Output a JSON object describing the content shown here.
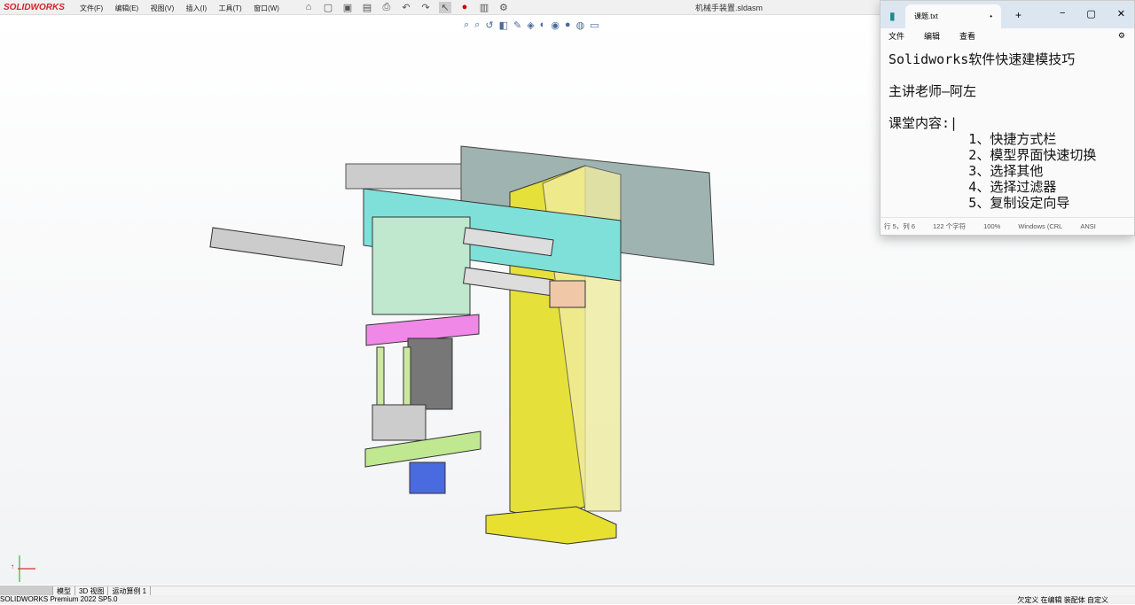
{
  "app": {
    "brand": "SOLIDWORKS",
    "menu": [
      "文件(F)",
      "编辑(E)",
      "视图(V)",
      "插入(I)",
      "工具(T)",
      "窗口(W)"
    ],
    "doc_title": "机械手装置.sldasm"
  },
  "tabs": [
    "模型",
    "3D 视图",
    "运动算例 1"
  ],
  "status": {
    "version": "SOLIDWORKS Premium 2022 SP5.0",
    "right": "欠定义   在编辑 装配体        自定义"
  },
  "notepad": {
    "tab": "课题.txt",
    "menu": [
      "文件",
      "编辑",
      "查看"
    ],
    "lines": [
      "Solidworks软件快速建模技巧",
      "",
      "主讲老师—阿左",
      "",
      "课堂内容:|",
      "          1、快捷方式栏",
      "          2、模型界面快速切换",
      "          3、选择其他",
      "          4、选择过滤器",
      "          5、复制设定向导"
    ],
    "status": [
      "行 5，列 6",
      "122 个字符",
      "100%",
      "Windows (CRL",
      "ANSI"
    ]
  }
}
